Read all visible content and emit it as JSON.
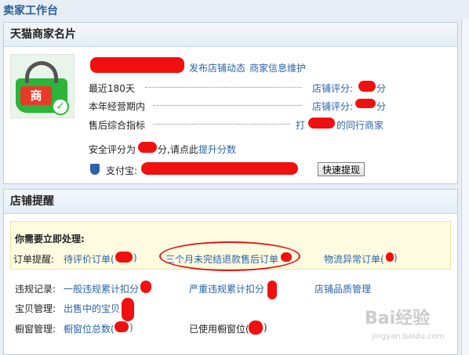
{
  "page_title": "卖家工作台",
  "merchant_card": {
    "title": "天猫商家名片",
    "logo_label": "商",
    "top_links": [
      "发布店铺动态",
      "商家信息维护"
    ],
    "rows": [
      {
        "label": "最近180天",
        "right_label": "店铺评分:",
        "right_suffix": "分"
      },
      {
        "label": "本年经营期内",
        "right_label": "店铺评分:",
        "right_suffix": "分"
      },
      {
        "label": "售后综合指标",
        "right_label": "打",
        "right_suffix": "的同行商家"
      }
    ],
    "security": {
      "prefix": "安全评分为",
      "suffix": "分,请点此",
      "link": "提升分数"
    },
    "alipay": {
      "label": "支付宝:",
      "button": "快速提现"
    }
  },
  "store_reminder": {
    "title": "店铺提醒",
    "alert_heading": "你需要立即处理:",
    "order_label": "订单提醒:",
    "order_items": [
      "待评价订单(",
      "三个月未完结退款售后订单",
      "物流异常订单("
    ],
    "order_suffix": ")",
    "rows": [
      {
        "label": "违规记录:",
        "items": [
          "一般违规累计扣分",
          "严重违规累计扣分",
          "店铺品质管理"
        ]
      },
      {
        "label": "宝贝管理:",
        "items": [
          "出售中的宝贝"
        ]
      },
      {
        "label": "橱窗管理:",
        "items": [
          "橱窗位总数(",
          "已使用橱窗位("
        ]
      }
    ],
    "window_suffix": ")"
  },
  "watermark": {
    "text": "Bai经验",
    "sub": "jingyan.baidu.com"
  },
  "colors": {
    "link": "#2a63a8",
    "redaction": "#f01010",
    "alert_bg": "#fffbe0"
  }
}
